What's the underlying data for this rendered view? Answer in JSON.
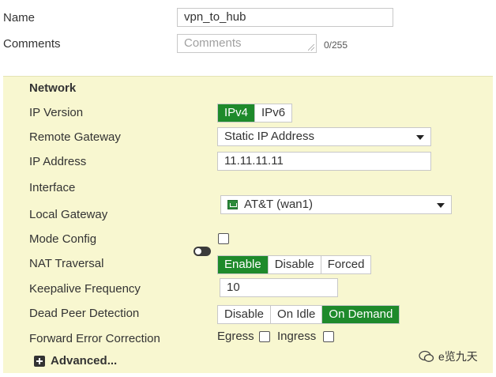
{
  "form": {
    "name_label": "Name",
    "name_value": "vpn_to_hub",
    "comments_label": "Comments",
    "comments_placeholder": "Comments",
    "comments_counter": "0/255"
  },
  "network": {
    "title": "Network",
    "ip_version": {
      "label": "IP Version",
      "options": [
        "IPv4",
        "IPv6"
      ],
      "selected": "IPv4"
    },
    "remote_gateway": {
      "label": "Remote Gateway",
      "value": "Static IP Address"
    },
    "ip_address": {
      "label": "IP Address",
      "value": "11.11.11.11"
    },
    "interface": {
      "label": "Interface",
      "value": "AT&T (wan1)",
      "icon": "interface-port-icon"
    },
    "local_gateway": {
      "label": "Local Gateway",
      "enabled": false
    },
    "mode_config": {
      "label": "Mode Config",
      "checked": false
    },
    "nat_traversal": {
      "label": "NAT Traversal",
      "options": [
        "Enable",
        "Disable",
        "Forced"
      ],
      "selected": "Enable"
    },
    "keepalive": {
      "label": "Keepalive Frequency",
      "value": "10"
    },
    "dpd": {
      "label": "Dead Peer Detection",
      "options": [
        "Disable",
        "On Idle",
        "On Demand"
      ],
      "selected": "On Demand"
    },
    "fec": {
      "label": "Forward Error Correction",
      "egress_label": "Egress",
      "ingress_label": "Ingress",
      "egress_checked": false,
      "ingress_checked": false
    },
    "advanced_label": "Advanced..."
  },
  "watermark": {
    "text": "e览九天"
  },
  "colors": {
    "accent_green": "#1e8a2b",
    "panel_bg": "#f8f7d0"
  }
}
